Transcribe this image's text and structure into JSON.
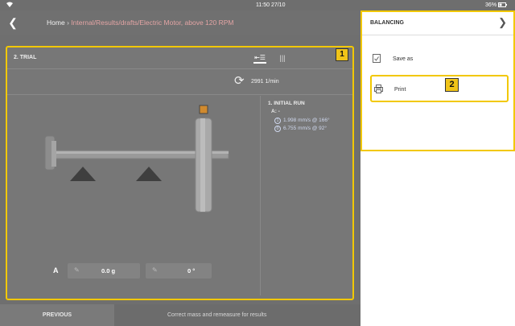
{
  "status_bar": {
    "time": "11:50 27/10",
    "battery": "36%"
  },
  "nav": {
    "home": "Home",
    "separator": "›",
    "path": "Internal/Results/drafts/Electric Motor, above 120 RPM"
  },
  "markers": {
    "one": "1",
    "two": "2"
  },
  "trial": {
    "title": "2. TRIAL",
    "speed": "2991 1/min",
    "initial_run_title": "1. INITIAL RUN",
    "plane_label": "A: -",
    "measurements": [
      {
        "index": "1",
        "value": "1.998 mm/s @ 166°"
      },
      {
        "index": "0",
        "value": "6.755 mm/s @ 92°"
      }
    ],
    "plane": "A",
    "mass_value": "0.0 g",
    "angle_value": "0 °"
  },
  "panel": {
    "title": "BALANCING",
    "items": [
      {
        "label": "Save as",
        "icon": "save-document-icon"
      },
      {
        "label": "Print",
        "icon": "printer-icon"
      }
    ]
  },
  "bottom": {
    "previous_label": "PREVIOUS",
    "hint": "Correct mass and remeasure for results"
  },
  "colors": {
    "highlight": "#f2c800",
    "overlay": "#707070",
    "panel_bg": "#ffffff",
    "measurement_text": "#cfd8ee"
  }
}
